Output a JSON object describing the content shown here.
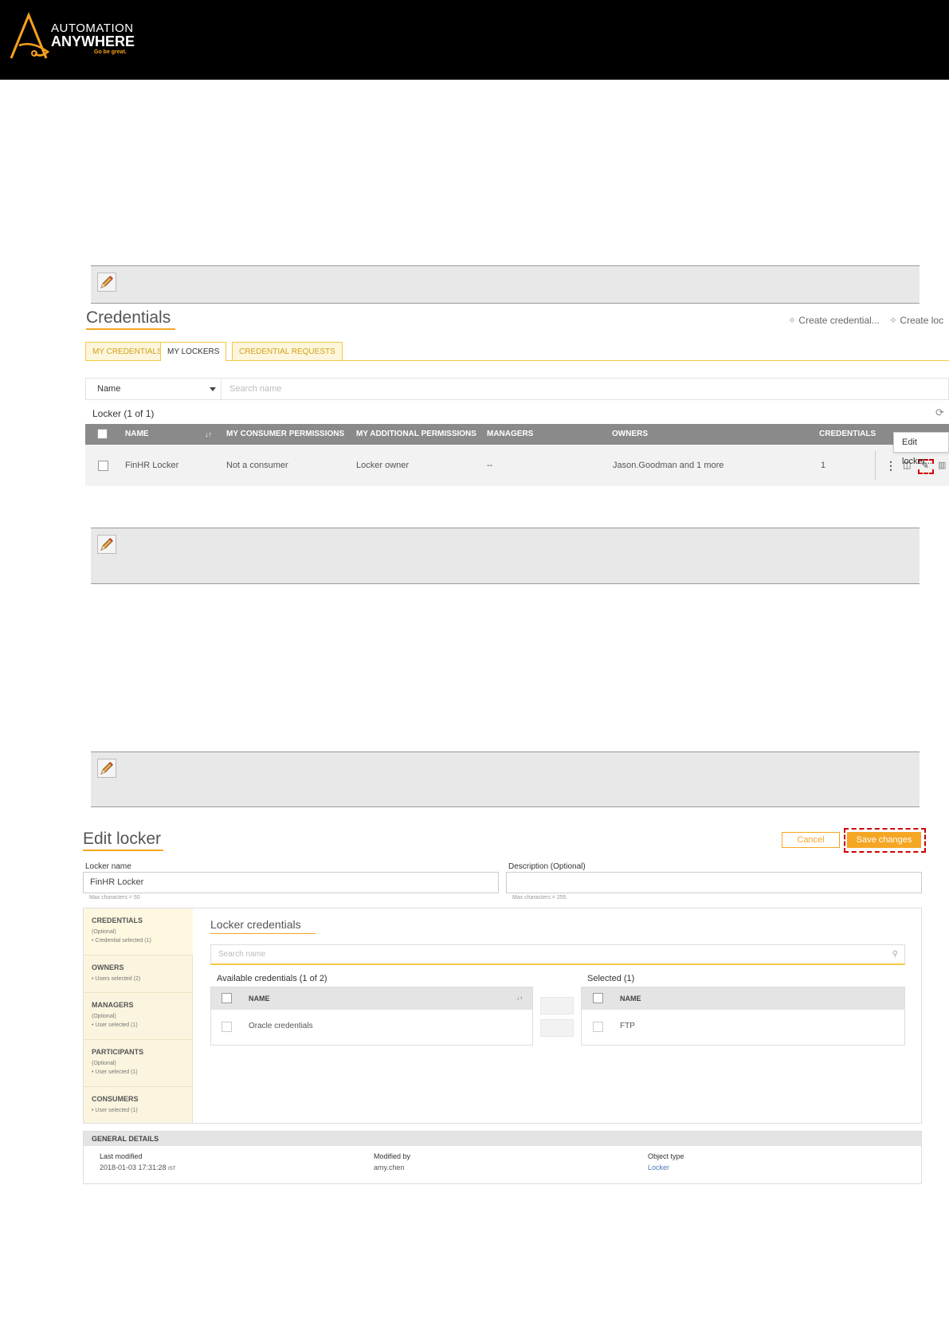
{
  "brand": {
    "line1": "AUTOMATION",
    "line2": "ANYWHERE",
    "tagline": "Go be great."
  },
  "credentials": {
    "title": "Credentials",
    "create_credential": "Create credential...",
    "create_locker": "Create loc",
    "tabs": [
      "MY CREDENTIALS",
      "MY LOCKERS",
      "CREDENTIAL REQUESTS"
    ],
    "filter_field": "Name",
    "search_placeholder": "Search name",
    "count_label": "Locker (1 of 1)",
    "columns": [
      "NAME",
      "MY CONSUMER PERMISSIONS",
      "MY ADDITIONAL PERMISSIONS",
      "MANAGERS",
      "OWNERS",
      "CREDENTIALS"
    ],
    "row": {
      "name": "FinHR Locker",
      "consumer": "Not a consumer",
      "additional": "Locker owner",
      "managers": "--",
      "owners": "Jason.Goodman and 1 more",
      "credentials": "1"
    },
    "tooltip": "Edit locker..."
  },
  "edit_locker": {
    "title": "Edit locker",
    "cancel": "Cancel",
    "save": "Save changes",
    "name_label": "Locker name",
    "name_value": "FinHR Locker",
    "name_hint": "Max characters = 50",
    "desc_label": "Description (Optional)",
    "desc_hint": "Max characters = 255",
    "sidebar": [
      {
        "title": "CREDENTIALS",
        "sub1": "(Optional)",
        "sub2": "• Credential selected (1)"
      },
      {
        "title": "OWNERS",
        "sub1": "",
        "sub2": "• Users selected (2)"
      },
      {
        "title": "MANAGERS",
        "sub1": "(Optional)",
        "sub2": "• User selected (1)"
      },
      {
        "title": "PARTICIPANTS",
        "sub1": "(Optional)",
        "sub2": "• User selected (1)"
      },
      {
        "title": "CONSUMERS",
        "sub1": "",
        "sub2": "• User selected (1)"
      }
    ],
    "section_title": "Locker credentials",
    "search_placeholder": "Search name",
    "available_label": "Available credentials (1 of 2)",
    "selected_label": "Selected (1)",
    "col_name": "NAME",
    "available_item": "Oracle credentials",
    "selected_item": "FTP",
    "general": {
      "header": "GENERAL DETAILS",
      "last_modified_label": "Last modified",
      "last_modified_value": "2018-01-03 17:31:28",
      "tz": "IST",
      "modified_by_label": "Modified by",
      "modified_by_value": "amy.chen",
      "object_type_label": "Object type",
      "object_type_value": "Locker"
    }
  },
  "colors": {
    "accent": "#f5a623",
    "header_bg": "#000000",
    "highlight": "#cc0000"
  }
}
